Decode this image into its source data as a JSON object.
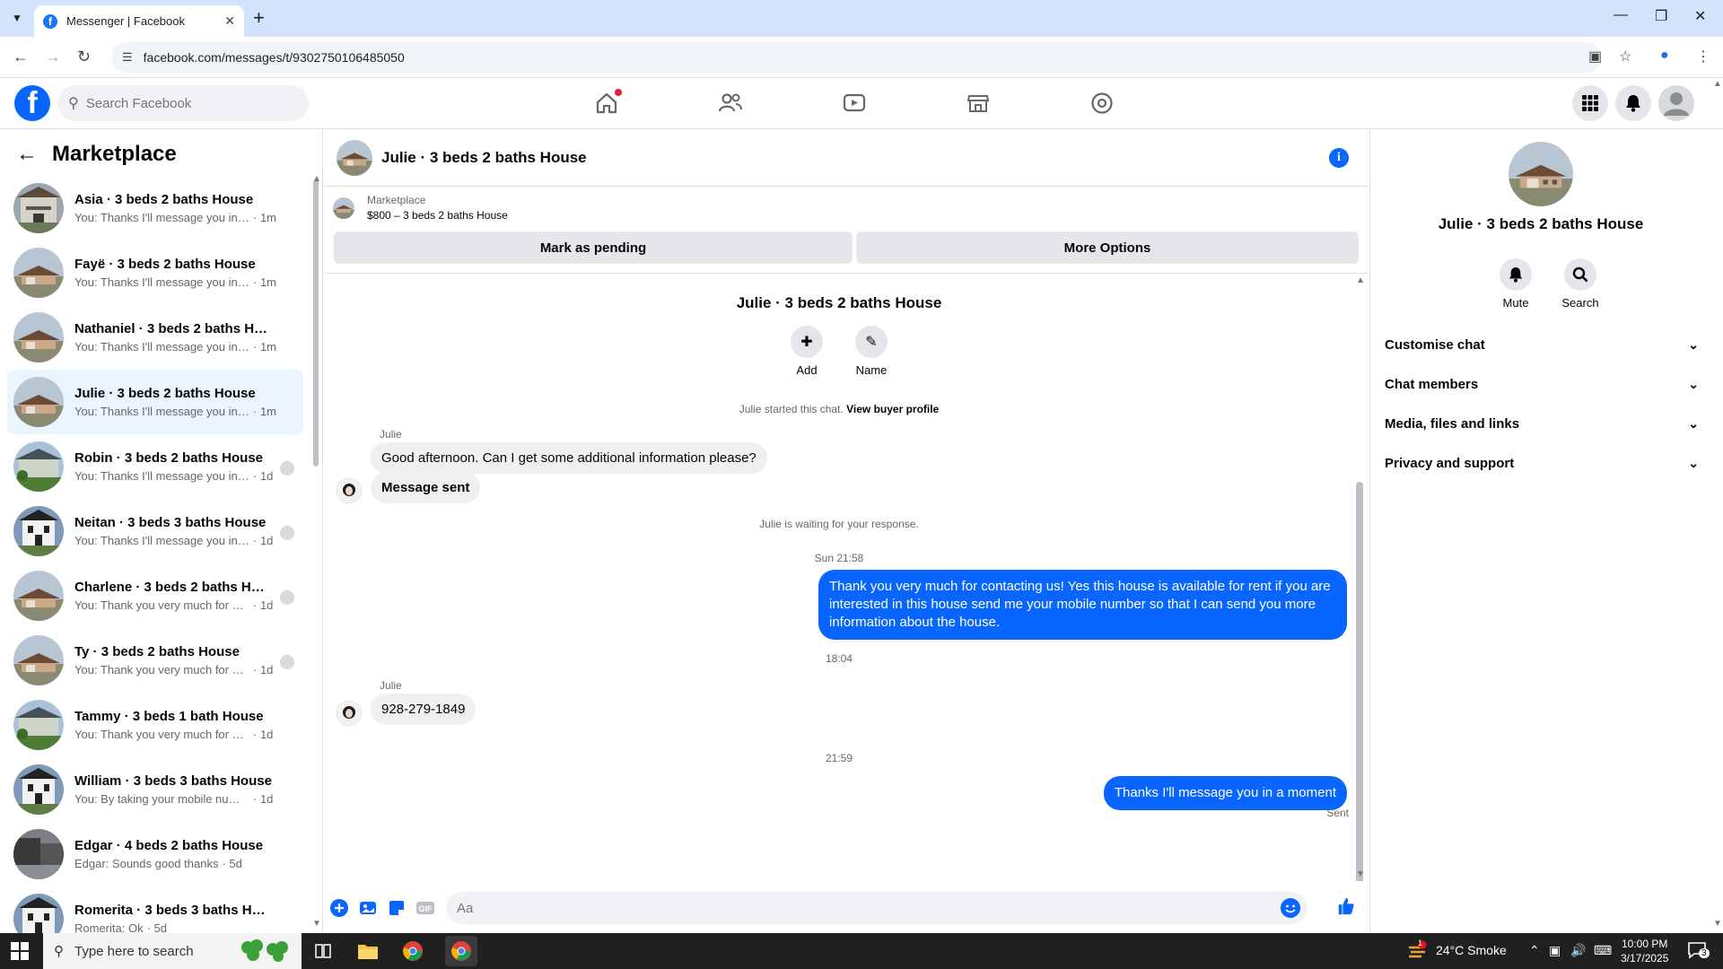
{
  "browser": {
    "tab_title": "Messenger | Facebook",
    "url": "facebook.com/messages/t/9302750106485050"
  },
  "fb": {
    "search_placeholder": "Search Facebook"
  },
  "sidebar": {
    "title": "Marketplace",
    "conversations": [
      {
        "name": "Asia · 3 beds 2 baths House",
        "preview": "You: Thanks I'll message you in a ...",
        "time": "· 1m",
        "thumb": "porch"
      },
      {
        "name": "Fayë · 3 beds 2 baths House",
        "preview": "You: Thanks I'll message you in a ...",
        "time": "· 1m",
        "thumb": "ranch"
      },
      {
        "name": "Nathaniel · 3 beds 2 baths House",
        "preview": "You: Thanks I'll message you in a ...",
        "time": "· 1m",
        "thumb": "ranch"
      },
      {
        "name": "Julie · 3 beds 2 baths House",
        "preview": "You: Thanks I'll message you in a ...",
        "time": "· 1m",
        "thumb": "ranch",
        "active": true
      },
      {
        "name": "Robin · 3 beds 2 baths House",
        "preview": "You: Thanks I'll message you in ...",
        "time": "· 1d",
        "thumb": "green"
      },
      {
        "name": "Neitan · 3 beds 3 baths House",
        "preview": "You: Thanks I'll message you in ...",
        "time": "· 1d",
        "thumb": "white"
      },
      {
        "name": "Charlene · 3 beds 2 baths Hou...",
        "preview": "You: Thank you very much for co...",
        "time": "· 1d",
        "thumb": "ranch"
      },
      {
        "name": "Ty · 3 beds 2 baths House",
        "preview": "You: Thank you very much for co...",
        "time": "· 1d",
        "thumb": "ranch"
      },
      {
        "name": "Tammy · 3 beds 1 bath House",
        "preview": "You: Thank you very much for cont...",
        "time": "· 1d",
        "thumb": "green"
      },
      {
        "name": "William · 3 beds 3 baths House",
        "preview": "You: By taking your mobile number...",
        "time": "· 1d",
        "thumb": "white"
      },
      {
        "name": "Edgar · 4 beds 2 baths House",
        "preview": "Edgar: Sounds good thanks",
        "time": "· 5d",
        "thumb": "dark"
      },
      {
        "name": "Romerita · 3 beds 3 baths House",
        "preview": "Romerita: Ok",
        "time": "· 5d",
        "thumb": "white"
      }
    ]
  },
  "chat": {
    "header_title": "Julie · 3 beds 2 baths House",
    "marketplace_label": "Marketplace",
    "listing": "$800 – 3 beds 2 baths House",
    "mark_pending": "Mark as pending",
    "more_options": "More Options",
    "big_name": "Julie · 3 beds 2 baths House",
    "add_label": "Add",
    "name_label": "Name",
    "started_text": "Julie started this chat.",
    "view_profile": "View buyer profile",
    "sender": "Julie",
    "msg1": "Good afternoon. Can I get some additional information please?",
    "msg2": "Message sent",
    "waiting": "Julie is waiting for your response.",
    "ts1": "Sun 21:58",
    "out1": "Thank you very much for contacting us! Yes this house is available for rent if you are interested in this house send me your mobile number so that I can send you more information about the house.",
    "ts2": "18:04",
    "phone": "928-279-1849",
    "ts3": "21:59",
    "out2": "Thanks I'll message you in a moment",
    "sent": "Sent",
    "composer_placeholder": "Aa"
  },
  "panel": {
    "name": "Julie · 3 beds 2 baths House",
    "mute": "Mute",
    "search": "Search",
    "sections": [
      "Customise chat",
      "Chat members",
      "Media, files and links",
      "Privacy and support"
    ]
  },
  "taskbar": {
    "search_text": "Type here to search",
    "weather": "24°C  Smoke",
    "time": "10:00 PM",
    "date": "3/17/2025",
    "notif_count": "3",
    "weather_badge": "1"
  },
  "colors": {
    "accent": "#0866ff",
    "active_row": "#ebf5ff"
  }
}
